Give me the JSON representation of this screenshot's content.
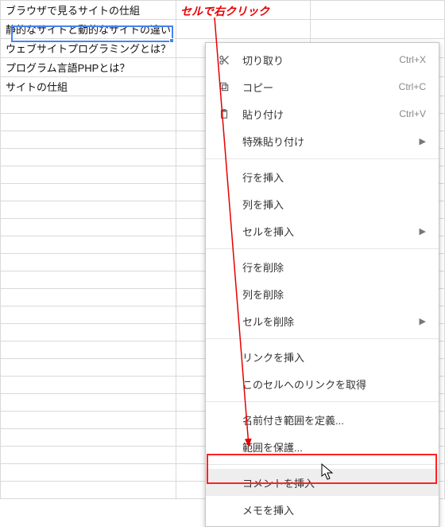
{
  "annotation": {
    "text": "セルで右クリック"
  },
  "cells": {
    "rows": [
      "ブラウザで見るサイトの仕組",
      "静的なサイトと動的なサイトの違い",
      "ウェブサイトプログラミングとは？",
      "プログラム言語PHPとは？",
      "サイトの仕組"
    ],
    "selected_index": 1
  },
  "menu": {
    "cut": {
      "label": "切り取り",
      "shortcut": "Ctrl+X"
    },
    "copy": {
      "label": "コピー",
      "shortcut": "Ctrl+C"
    },
    "paste": {
      "label": "貼り付け",
      "shortcut": "Ctrl+V"
    },
    "paste_sp": {
      "label": "特殊貼り付け"
    },
    "ins_row": {
      "label": "行を挿入"
    },
    "ins_col": {
      "label": "列を挿入"
    },
    "ins_cell": {
      "label": "セルを挿入"
    },
    "del_row": {
      "label": "行を削除"
    },
    "del_col": {
      "label": "列を削除"
    },
    "del_cell": {
      "label": "セルを削除"
    },
    "ins_link": {
      "label": "リンクを挿入"
    },
    "get_link": {
      "label": "このセルへのリンクを取得"
    },
    "def_range": {
      "label": "名前付き範囲を定義..."
    },
    "protect": {
      "label": "範囲を保護..."
    },
    "comment": {
      "label": "コメントを挿入"
    },
    "memo": {
      "label": "メモを挿入"
    }
  }
}
